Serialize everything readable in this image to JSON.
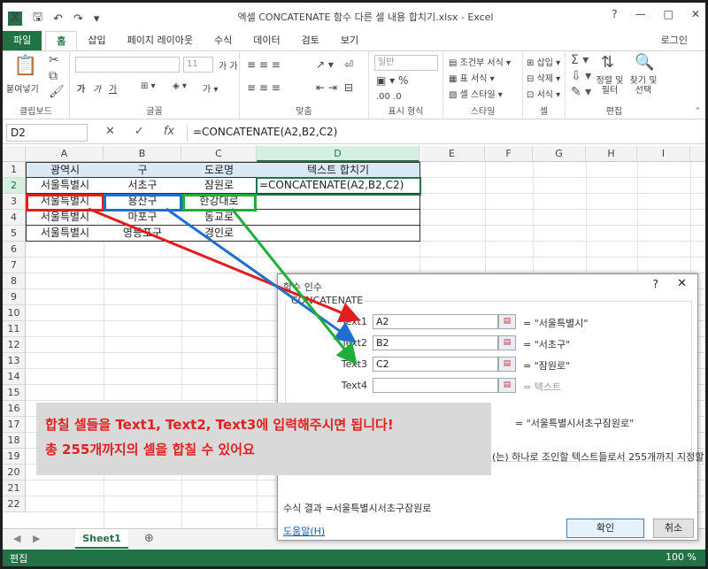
{
  "titlebar": {
    "logo": "X",
    "title": "엑셀 CONCATENATE 함수 다른 셀 내용 합치기.xlsx - Excel",
    "help": "?",
    "minimize": "—",
    "maximize": "□",
    "close": "✕"
  },
  "tabs": [
    "파일",
    "홈",
    "삽입",
    "페이지 레이아웃",
    "수식",
    "데이터",
    "검토",
    "보기"
  ],
  "login": "로그인",
  "ribbon": {
    "paste": "붙여넣기",
    "clipboard": "클립보드",
    "font_size": "11",
    "font_group": "글꼴",
    "align_group": "맞춤",
    "number_format": "일반",
    "number_group": "표시 형식",
    "cond_format": "조건부 서식",
    "table_format": "표 서식",
    "cell_style": "셀 스타일",
    "style_group": "스타일",
    "insert": "삽입",
    "delete": "삭제",
    "format": "서식",
    "cells_group": "셀",
    "sort_filter": "정렬 및\n필터",
    "find_select": "찾기 및\n선택",
    "edit_group": "편집"
  },
  "formula_bar": {
    "name_box": "D2",
    "cancel": "✕",
    "enter": "✓",
    "fx": "fx",
    "formula": "=CONCATENATE(A2,B2,C2)"
  },
  "columns": [
    "A",
    "B",
    "C",
    "D",
    "E",
    "F",
    "G",
    "H",
    "I"
  ],
  "rows": [
    "1",
    "2",
    "3",
    "4",
    "5",
    "6",
    "7",
    "8",
    "9",
    "10",
    "11",
    "12",
    "13",
    "14",
    "15",
    "16",
    "17",
    "18",
    "19",
    "20",
    "21",
    "22"
  ],
  "table": {
    "headers": [
      "광역시",
      "구",
      "도로명",
      "텍스트 합치기"
    ],
    "rows": [
      [
        "서울특별시",
        "서초구",
        "잠원로",
        "=CONCATENATE(A2,B2,C2)"
      ],
      [
        "서울특별시",
        "용산구",
        "한강대로",
        ""
      ],
      [
        "서울특별시",
        "마포구",
        "동교로",
        ""
      ],
      [
        "서울특별시",
        "영등포구",
        "경인로",
        ""
      ]
    ]
  },
  "highlight_colors": {
    "A": "#e31c1c",
    "B": "#1f6fcf",
    "C": "#1fae3a"
  },
  "sheet_tab": "Sheet1",
  "add_sheet": "⊕",
  "status": {
    "mode": "편집",
    "zoom": "100 %"
  },
  "dialog": {
    "title": "함수 인수",
    "help": "?",
    "close": "✕",
    "function_name": "CONCATENATE",
    "args": [
      {
        "label": "Text1",
        "value": "A2",
        "result": "= \"서울특별시\""
      },
      {
        "label": "Text2",
        "value": "B2",
        "result": "= \"서초구\""
      },
      {
        "label": "Text3",
        "value": "C2",
        "result": "= \"잠원로\""
      },
      {
        "label": "Text4",
        "value": "",
        "result": "= 텍스트"
      }
    ],
    "total": "= \"서울특별시서초구잠원로\"",
    "description": "(는) 하나로 조인할 텍스트들로서 255개까지 지정할",
    "result_label": "수식 결과 =",
    "result_value": "서울특별시서초구잠원로",
    "help_link": "도움말(H)",
    "ok": "확인",
    "cancel": "취소"
  },
  "callout": {
    "line1": "합칠 셀들을 Text1, Text2, Text3에 입력해주시면 됩니다!",
    "line2": "총 255개까지의 셀을 합칠 수 있어요"
  }
}
